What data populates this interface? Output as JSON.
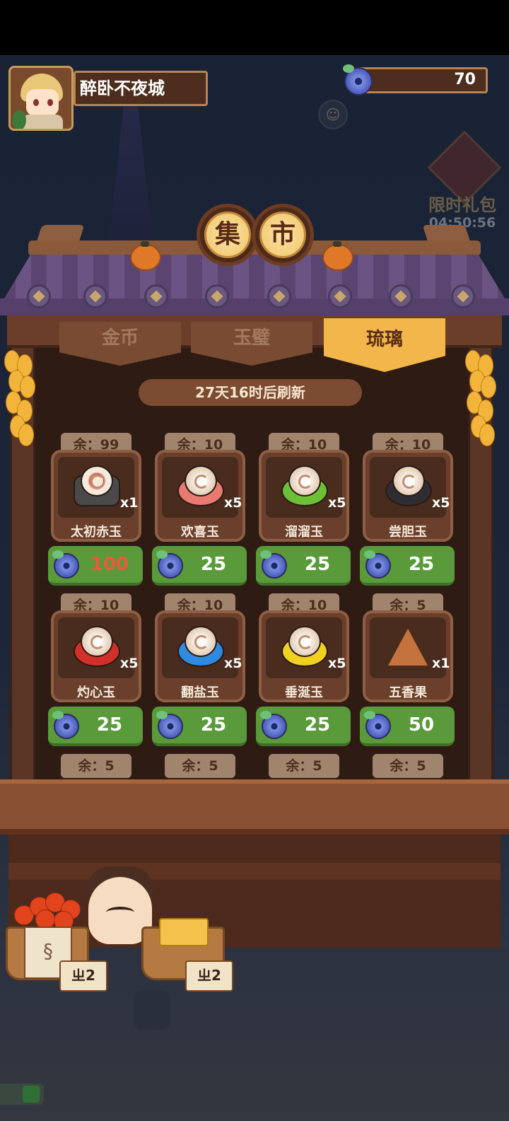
{
  "player": {
    "name": "醉卧不夜城"
  },
  "currency": {
    "icon": "jade-coin-icon",
    "amount": "70"
  },
  "limited_gift": {
    "label": "限时礼包",
    "timer": "04:50:56"
  },
  "market_title": [
    "集",
    "市"
  ],
  "tabs": [
    {
      "label": "金币",
      "active": false
    },
    {
      "label": "玉璧",
      "active": false
    },
    {
      "label": "琉璃",
      "active": true
    }
  ],
  "refresh_text": "27天16时后刷新",
  "items": [
    {
      "name": "太初赤玉",
      "stock": "余：99",
      "qty": "x1",
      "price": "100",
      "price_color": "#ea5a3c",
      "base_color": "#4a4a4a"
    },
    {
      "name": "欢喜玉",
      "stock": "余：10",
      "qty": "x5",
      "price": "25",
      "price_color": "#ffffff",
      "base_color": "#e87a72"
    },
    {
      "name": "溜溜玉",
      "stock": "余：10",
      "qty": "x5",
      "price": "25",
      "price_color": "#ffffff",
      "base_color": "#6cc036"
    },
    {
      "name": "尝胆玉",
      "stock": "余：10",
      "qty": "x5",
      "price": "25",
      "price_color": "#ffffff",
      "base_color": "#2e2e32"
    },
    {
      "name": "灼心玉",
      "stock": "余：10",
      "qty": "x5",
      "price": "25",
      "price_color": "#ffffff",
      "base_color": "#d2302a"
    },
    {
      "name": "翻盐玉",
      "stock": "余：10",
      "qty": "x5",
      "price": "25",
      "price_color": "#ffffff",
      "base_color": "#2f8ae0"
    },
    {
      "name": "垂涎玉",
      "stock": "余：10",
      "qty": "x5",
      "price": "25",
      "price_color": "#ffffff",
      "base_color": "#f0d020"
    },
    {
      "name": "五香果",
      "stock": "余：5",
      "qty": "x1",
      "price": "50",
      "price_color": "#ffffff",
      "base_color": "#c4733e"
    }
  ],
  "partial_row_stock": [
    "余：5",
    "余：5",
    "余：5",
    "余：5"
  ],
  "vendor_signs": [
    "ㄓ2",
    "ㄓ2"
  ],
  "colors": {
    "price_button": "#5a9a3a",
    "tab_active": "#f2b64b",
    "wood": "#6b3e2a"
  }
}
